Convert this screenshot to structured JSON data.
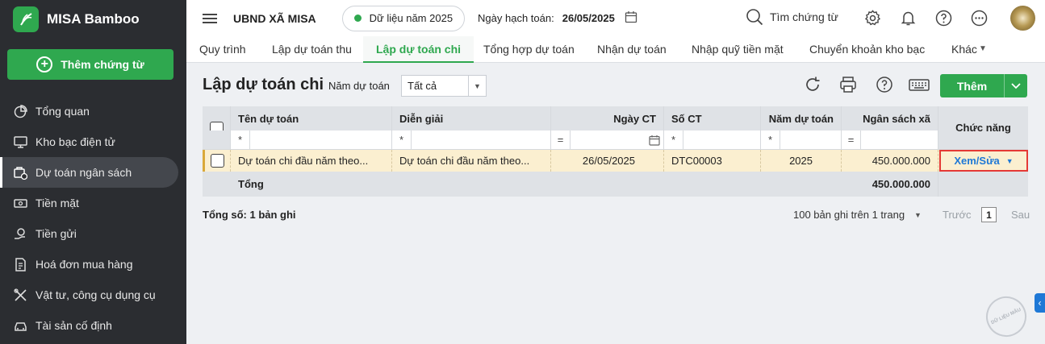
{
  "app": {
    "name": "MISA Bamboo",
    "add_voucher": "Thêm chứng từ"
  },
  "sidebar": {
    "items": [
      {
        "label": "Tổng quan",
        "icon": "pie-chart-icon"
      },
      {
        "label": "Kho bạc điện tử",
        "icon": "monitor-icon"
      },
      {
        "label": "Dự toán ngân sách",
        "icon": "budget-icon",
        "active": true
      },
      {
        "label": "Tiền mặt",
        "icon": "cash-icon"
      },
      {
        "label": "Tiền gửi",
        "icon": "deposit-icon"
      },
      {
        "label": "Hoá đơn mua hàng",
        "icon": "invoice-icon"
      },
      {
        "label": "Vật tư, công cụ dụng cụ",
        "icon": "tools-icon"
      },
      {
        "label": "Tài sản cố định",
        "icon": "asset-icon"
      }
    ]
  },
  "topbar": {
    "org": "UBND XÃ MISA",
    "data_year": "Dữ liệu năm 2025",
    "posting_date_label": "Ngày hạch toán:",
    "posting_date": "26/05/2025",
    "search_label": "Tìm chứng từ"
  },
  "tabs": [
    "Quy trình",
    "Lập dự toán thu",
    "Lập dự toán chi",
    "Tổng hợp dự toán",
    "Nhận dự toán",
    "Nhập quỹ tiền mặt",
    "Chuyển khoản kho bạc",
    "Khác"
  ],
  "active_tab": 2,
  "page": {
    "title": "Lập dự toán chi",
    "year_filter_label": "Năm dự toán",
    "year_filter_value": "Tất cả",
    "add_button": "Thêm"
  },
  "table": {
    "columns": [
      "Tên dự toán",
      "Diễn giải",
      "Ngày CT",
      "Số CT",
      "Năm dự toán",
      "Ngân sách xã",
      "Chức năng"
    ],
    "filter_ops": [
      "*",
      "*",
      "=",
      "*",
      "*",
      "="
    ],
    "rows": [
      {
        "name": "Dự toán chi đầu năm theo...",
        "desc": "Dự toán chi đầu năm theo...",
        "date": "26/05/2025",
        "number": "DTC00003",
        "year": "2025",
        "budget": "450.000.000",
        "action": "Xem/Sửa"
      }
    ],
    "total_label": "Tổng",
    "total_budget": "450.000.000"
  },
  "footer": {
    "summary": "Tổng số: 1 bản ghi",
    "page_size": "100 bản ghi trên 1 trang",
    "prev": "Trước",
    "page": "1",
    "next": "Sau"
  },
  "stamp_text": "DỮ LIỆU MẪU",
  "colors": {
    "brand": "#2fa84f",
    "sidebar": "#2b2d31",
    "link": "#1e78d6",
    "highlight": "#e53935",
    "row": "#fbefd0"
  }
}
